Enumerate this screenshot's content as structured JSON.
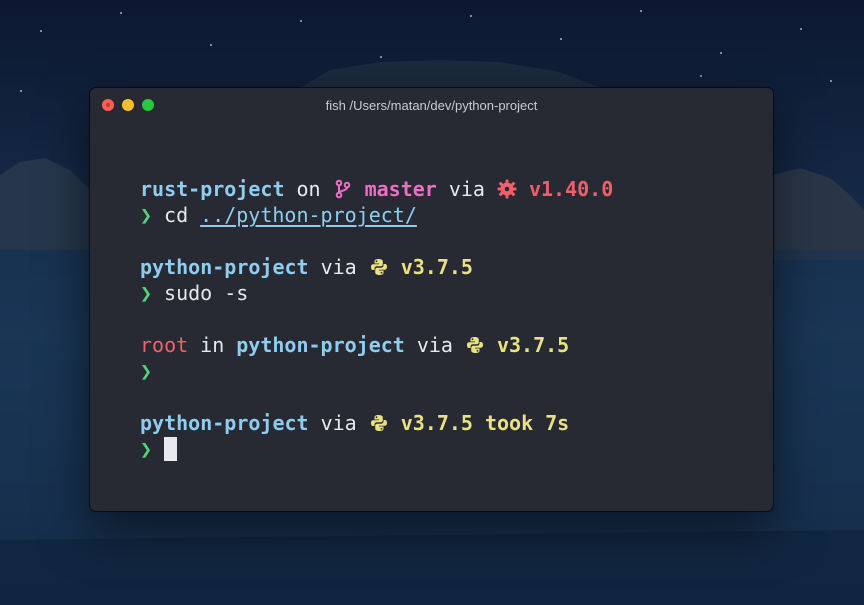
{
  "window": {
    "title": "fish /Users/matan/dev/python-project"
  },
  "terminal": {
    "line1": {
      "dir": "rust-project",
      "on": "on",
      "branch": "master",
      "via": "via",
      "version": "v1.40.0"
    },
    "line2": {
      "prompt": "❯",
      "cmd": "cd",
      "arg": "../python-project/"
    },
    "line3": {
      "dir": "python-project",
      "via": "via",
      "version": "v3.7.5"
    },
    "line4": {
      "prompt": "❯",
      "cmd": "sudo",
      "arg": "-s"
    },
    "line5": {
      "user": "root",
      "in": "in",
      "dir": "python-project",
      "via": "via",
      "version": "v3.7.5"
    },
    "line6": {
      "prompt": "❯"
    },
    "line7": {
      "dir": "python-project",
      "via": "via",
      "version": "v3.7.5",
      "took": "took",
      "duration": "7s"
    },
    "line8": {
      "prompt": "❯"
    }
  },
  "colors": {
    "directory": "#8ecdf0",
    "git_branch": "#ec6fc3",
    "rust_version": "#f0606b",
    "python_version": "#e8e282",
    "prompt": "#52d27c",
    "root_user": "#f0606b",
    "terminal_bg": "#282a33"
  },
  "icons": {
    "branch": "git-branch-icon",
    "rust": "rust-gear-icon",
    "python": "python-icon"
  }
}
